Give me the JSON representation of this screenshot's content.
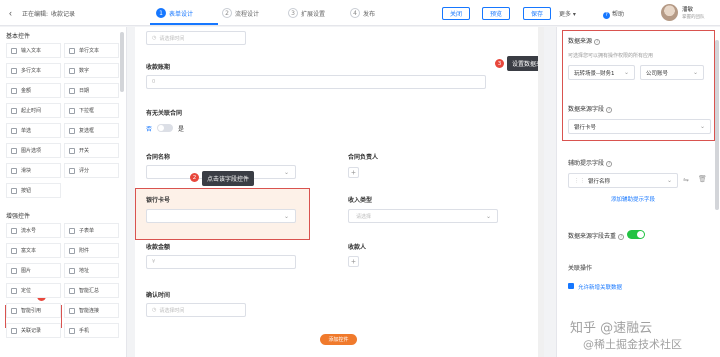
{
  "header": {
    "back_icon": "chevron-left-icon",
    "editing_label": "正在编辑:",
    "doc_title": "收款记录",
    "steps": [
      {
        "num": "1",
        "label": "表单设计"
      },
      {
        "num": "2",
        "label": "流程设计"
      },
      {
        "num": "3",
        "label": "扩展设置"
      },
      {
        "num": "4",
        "label": "发布"
      }
    ],
    "close_label": "关闭",
    "preview_label": "预览",
    "save_label": "保存",
    "more_label": "更多 ▾",
    "help_label": "帮助",
    "user_name": "潘敏",
    "user_team": "掌握的团队"
  },
  "left_panel": {
    "basic_title": "基本控件",
    "enhanced_title": "增强控件",
    "basic": [
      "输入文本",
      "单行文本",
      "多行文本",
      "数字",
      "金额",
      "日期",
      "起止时间",
      "下拉框",
      "单选",
      "复选框",
      "图片选项",
      "开关",
      "滑块",
      "评分",
      "按钮"
    ],
    "enhanced": [
      "流水号",
      "子表单",
      "富文本",
      "附件",
      "图片",
      "地址",
      "定位",
      "智能汇总",
      "智能引用",
      "智能连接",
      "关联记录",
      "手机"
    ],
    "badge": "1"
  },
  "canvas": {
    "top_input_placeholder": "请选择时间",
    "period_label": "收款账期",
    "period_placeholder": "0",
    "contract_q_label": "有无关联合同",
    "no_label": "否",
    "yes_label": "是",
    "contract_name_label": "合同名称",
    "contract_owner_label": "合同负责人",
    "bank_card_label": "银行卡号",
    "income_type_label": "收入类型",
    "income_type_placeholder": "请选择",
    "amount_label": "收款金额",
    "amount_placeholder": "¥",
    "payee_label": "收款人",
    "confirm_time_label": "确认时间",
    "confirm_time_placeholder": "请选择时间",
    "add_component": "添加控件",
    "tip_click": "点击该字段控件",
    "tip_click_badge": "2",
    "tip_source": "设置数据来源",
    "tip_source_badge": "3"
  },
  "right_panel": {
    "data_source_label": "数据来源",
    "data_source_hint": "可选择您可以拥有操作权限的所有应用",
    "app_select": "玩转场景--财务1",
    "table_select": "公司账号",
    "source_field_label": "数据来源字段",
    "source_field_value": "银行卡号",
    "aux_field_label": "辅助提示字段",
    "aux_field_value": "银行名称",
    "add_aux_field": "添加辅助提示字段",
    "dedupe_label": "数据来源字段去重",
    "linked_ops_label": "关联操作",
    "allow_new_label": "允许新增关联数据",
    "watermark_line1": "知乎 @速融云",
    "watermark_line2": "@稀土掘金技术社区"
  }
}
